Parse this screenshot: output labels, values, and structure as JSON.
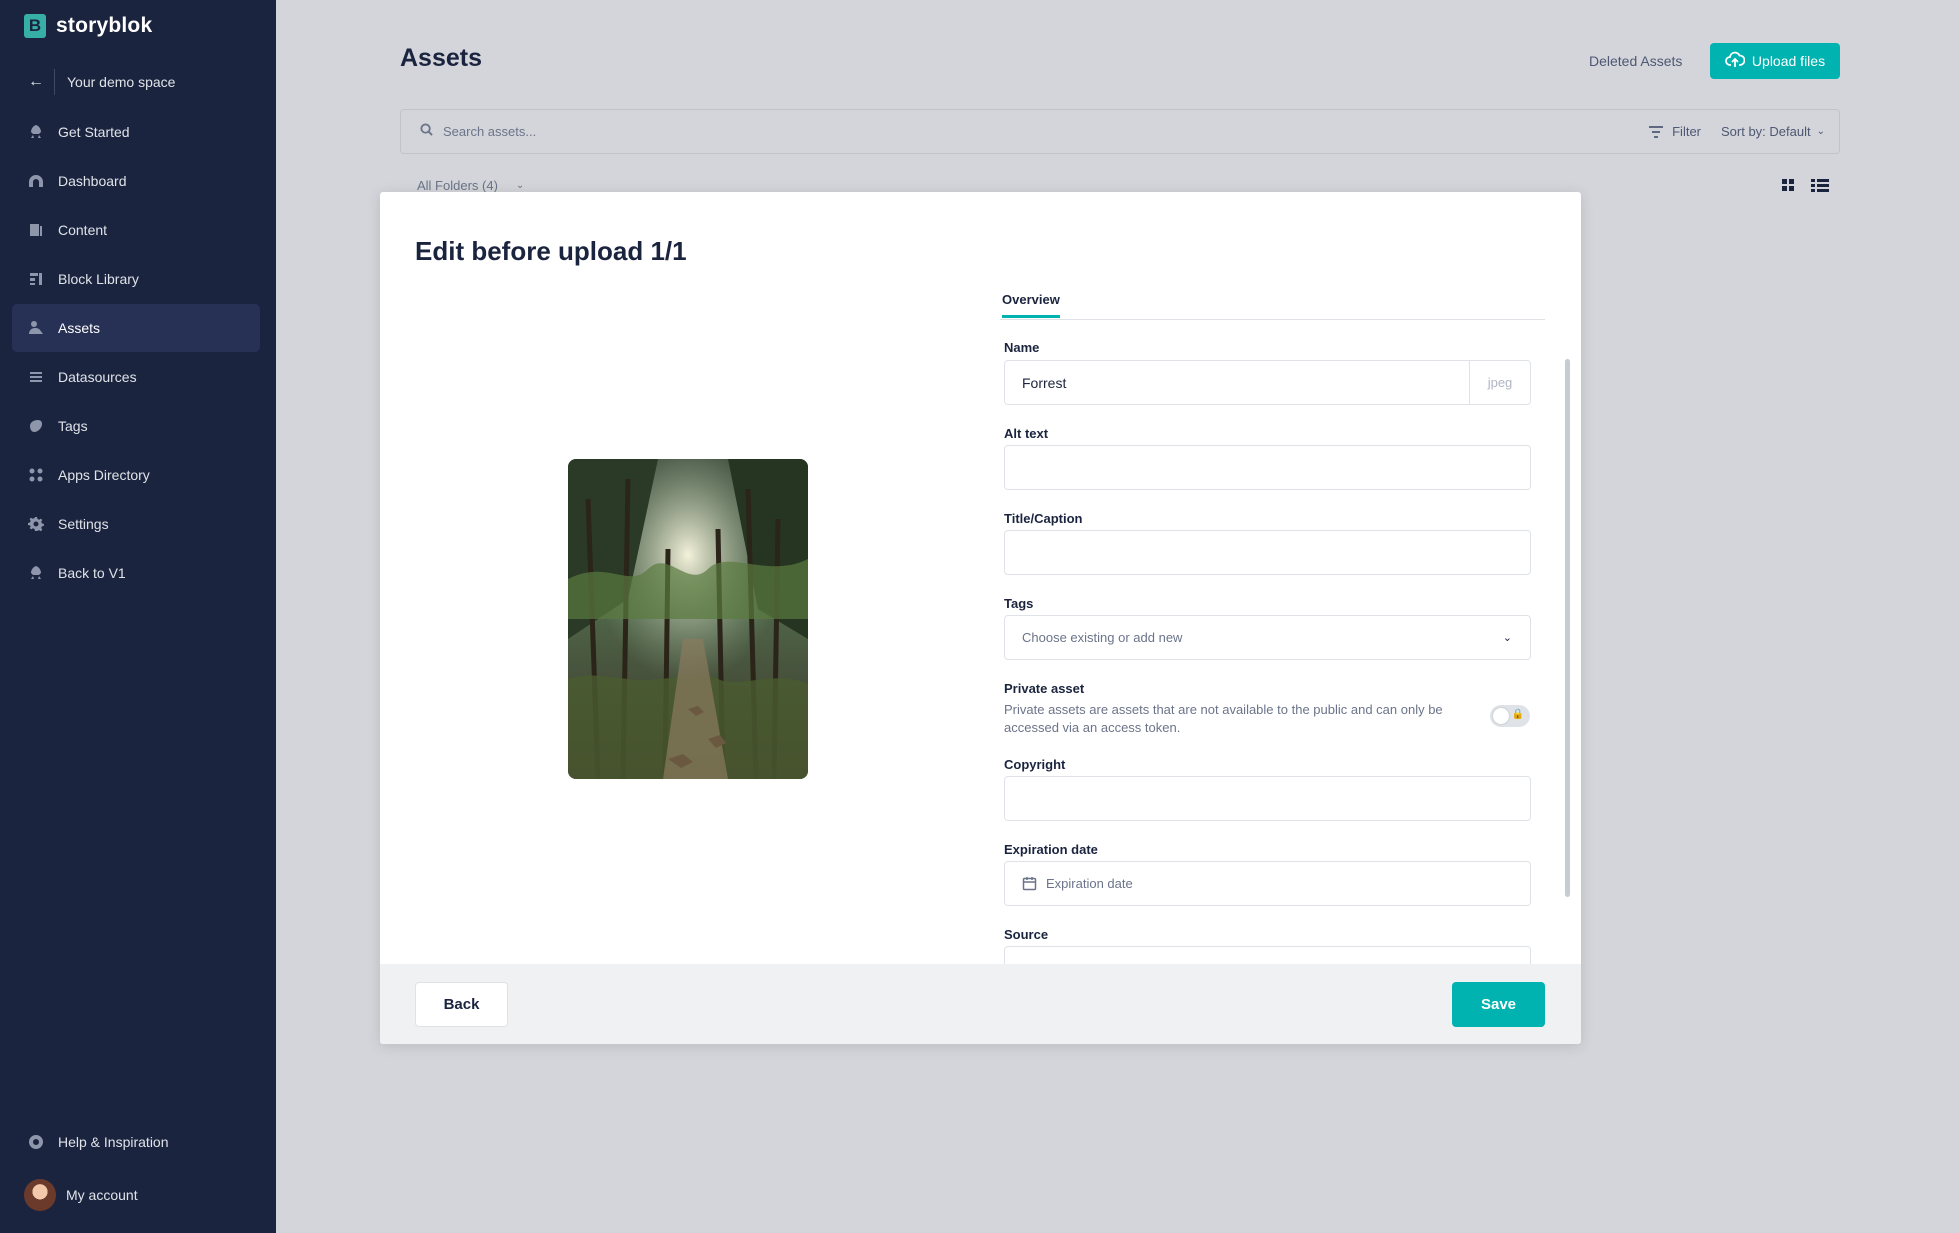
{
  "brand": {
    "name": "storyblok",
    "mark": "B"
  },
  "sidebar": {
    "back_label": "Your demo space",
    "items": [
      {
        "label": "Get Started",
        "icon": "rocket-icon"
      },
      {
        "label": "Dashboard",
        "icon": "dashboard-icon"
      },
      {
        "label": "Content",
        "icon": "content-icon"
      },
      {
        "label": "Block Library",
        "icon": "block-icon"
      },
      {
        "label": "Assets",
        "icon": "assets-icon",
        "active": true
      },
      {
        "label": "Datasources",
        "icon": "datasources-icon"
      },
      {
        "label": "Tags",
        "icon": "tag-icon"
      },
      {
        "label": "Apps Directory",
        "icon": "apps-icon"
      },
      {
        "label": "Settings",
        "icon": "gear-icon"
      },
      {
        "label": "Back to V1",
        "icon": "rocket-icon"
      }
    ],
    "help_label": "Help & Inspiration",
    "account_label": "My account"
  },
  "main": {
    "title": "Assets",
    "deleted_link": "Deleted Assets",
    "upload_label": "Upload files",
    "search_placeholder": "Search assets...",
    "filter_label": "Filter",
    "sort_label": "Sort by: Default",
    "folders_label": "All Folders (4)"
  },
  "modal": {
    "title": "Edit before upload 1/1",
    "tab": "Overview",
    "fields": {
      "name_label": "Name",
      "name_value": "Forrest",
      "name_ext": "jpeg",
      "alt_label": "Alt text",
      "title_label": "Title/Caption",
      "tags_label": "Tags",
      "tags_placeholder": "Choose existing or add new",
      "private_label": "Private asset",
      "private_desc": "Private assets are assets that are not available to the public and can only be accessed via an access token.",
      "private_enabled": false,
      "copyright_label": "Copyright",
      "expiration_label": "Expiration date",
      "expiration_placeholder": "Expiration date",
      "source_label": "Source"
    },
    "back_label": "Back",
    "save_label": "Save"
  },
  "colors": {
    "accent": "#00b3b0",
    "sidebar": "#1b243f"
  }
}
